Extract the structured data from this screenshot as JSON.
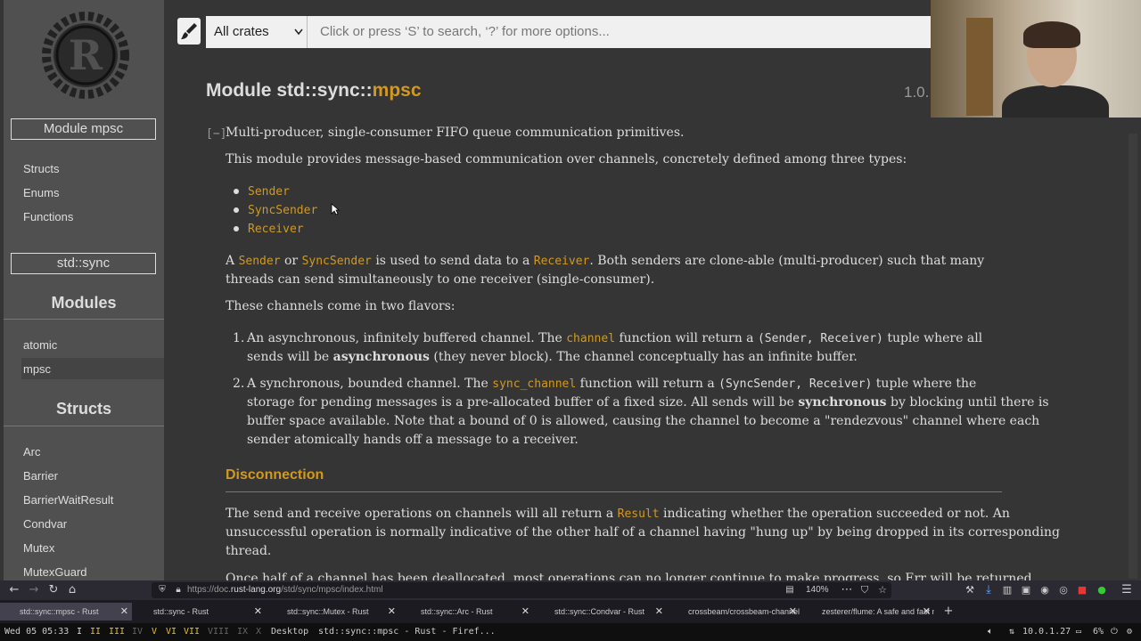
{
  "sidebar": {
    "module_box": "Module mpsc",
    "items_top": [
      "Structs",
      "Enums",
      "Functions"
    ],
    "parent_box": "std::sync",
    "modules_heading": "Modules",
    "modules": [
      "atomic",
      "mpsc"
    ],
    "structs_heading": "Structs",
    "structs": [
      "Arc",
      "Barrier",
      "BarrierWaitResult",
      "Condvar",
      "Mutex",
      "MutexGuard"
    ]
  },
  "search": {
    "crate_select": "All crates",
    "placeholder": "Click or press ‘S’ to search, ‘?’ for more options..."
  },
  "header": {
    "title_prefix": "Module std::sync::",
    "title_name": "mpsc",
    "version": "1.0."
  },
  "doc": {
    "toggle": "[−]",
    "summary": "Multi-producer, single-consumer FIFO queue communication primitives.",
    "intro": "This module provides message-based communication over channels, concretely defined among three types:",
    "types": [
      "Sender",
      "SyncSender",
      "Receiver"
    ],
    "para2": {
      "a": "A",
      "sender": "Sender",
      "or": "or",
      "syncsender": "SyncSender",
      "mid": "is used to send data to a",
      "receiver": "Receiver",
      "rest1": ". Both senders are clone-able (multi-producer) such that many",
      "rest2": "threads can send simultaneously to one receiver (single-consumer)."
    },
    "flavors": "These channels come in two flavors:",
    "item1": {
      "num": "1.",
      "a": "An asynchronous, infinitely buffered channel. The",
      "fn": "channel",
      "b": "function will return a",
      "tuple": "(Sender, Receiver)",
      "c": "tuple where all",
      "d": "sends will be",
      "bold": "asynchronous",
      "e": "(they never block). The channel conceptually has an infinite buffer."
    },
    "item2": {
      "num": "2.",
      "a": "A synchronous, bounded channel. The",
      "fn": "sync_channel",
      "b": "function will return a",
      "tuple": "(SyncSender, Receiver)",
      "c": "tuple where the",
      "d": "storage for pending messages is a pre-allocated buffer of a fixed size. All sends will be",
      "bold": "synchronous",
      "e": "by blocking until there is",
      "f": "buffer space available. Note that a bound of 0 is allowed, causing the channel to become a \"rendezvous\" channel where each",
      "g": "sender atomically hands off a message to a receiver."
    },
    "section_heading": "Disconnection",
    "disc": {
      "a": "The send and receive operations on channels will all return a",
      "result": "Result",
      "b": "indicating whether the operation succeeded or not. An",
      "c": "unsuccessful operation is normally indicative of the other half of a channel having \"hung up\" by being dropped in its corresponding",
      "d": "thread."
    },
    "cut_line": "Once half of a channel has been deallocated, most operations can no longer continue to make progress, so Err will be returned"
  },
  "browser": {
    "url_prefix": "https://doc.",
    "url_domain": "rust-lang.org",
    "url_path": "/std/sync/mpsc/index.html",
    "zoom": "140%",
    "tabs": [
      "std::sync::mpsc - Rust",
      "std::sync - Rust",
      "std::sync::Mutex - Rust",
      "std::sync::Arc - Rust",
      "std::sync::Condvar - Rust",
      "crossbeam/crossbeam-channel",
      "zesterer/flume: A safe and fast m"
    ]
  },
  "taskbar": {
    "clock": "Wed 05 05:33",
    "workspaces": [
      "I",
      "II",
      "III",
      "IV",
      "V",
      "VI",
      "VII",
      "VIII",
      "IX",
      "X"
    ],
    "desktop": "Desktop",
    "window_title": "std::sync::mpsc - Rust - Firef...",
    "ip": "10.0.1.27",
    "battery": "6%"
  },
  "colors": {
    "background": "#353535",
    "sidebar": "#505050",
    "accent": "#d2991d"
  }
}
